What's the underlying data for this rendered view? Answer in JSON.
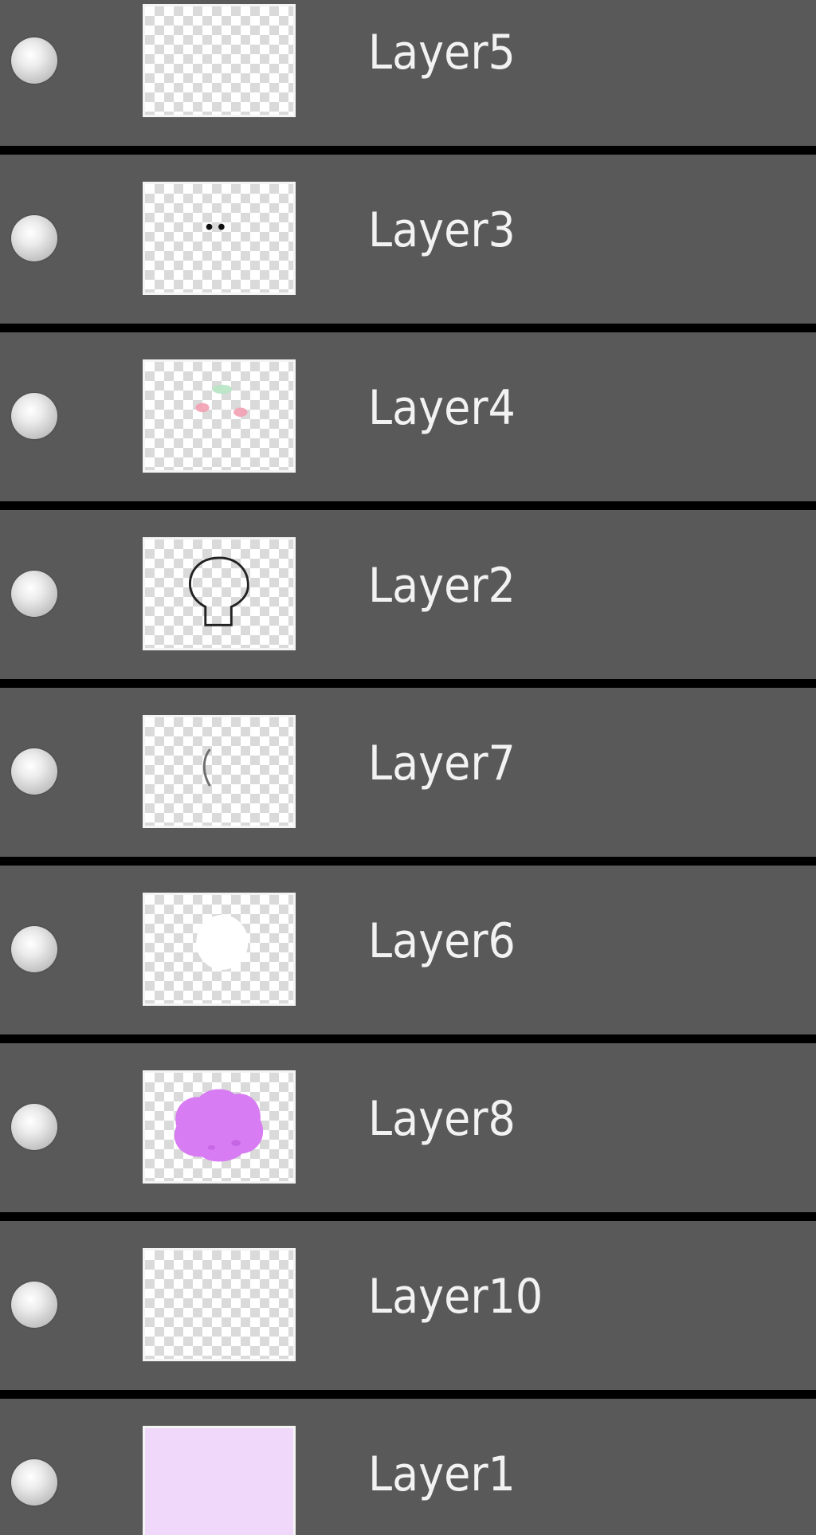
{
  "layers_panel": {
    "layers": [
      {
        "name": "Layer5",
        "visible": true,
        "thumbnail": "transparent-empty"
      },
      {
        "name": "Layer3",
        "visible": true,
        "thumbnail": "two-black-dots"
      },
      {
        "name": "Layer4",
        "visible": true,
        "thumbnail": "pink-and-green-marks"
      },
      {
        "name": "Layer2",
        "visible": true,
        "thumbnail": "head-outline"
      },
      {
        "name": "Layer7",
        "visible": true,
        "thumbnail": "small-curved-stroke"
      },
      {
        "name": "Layer6",
        "visible": true,
        "thumbnail": "white-blob"
      },
      {
        "name": "Layer8",
        "visible": true,
        "thumbnail": "purple-blob"
      },
      {
        "name": "Layer10",
        "visible": true,
        "thumbnail": "transparent-empty"
      },
      {
        "name": "Layer1",
        "visible": true,
        "thumbnail": "light-lavender-fill"
      }
    ],
    "colors": {
      "row_background": "#595959",
      "separator": "#000000",
      "label_text": "#f2f2f2",
      "purple_blob": "#d77cf2",
      "lavender_fill": "#f0d8fb"
    }
  }
}
